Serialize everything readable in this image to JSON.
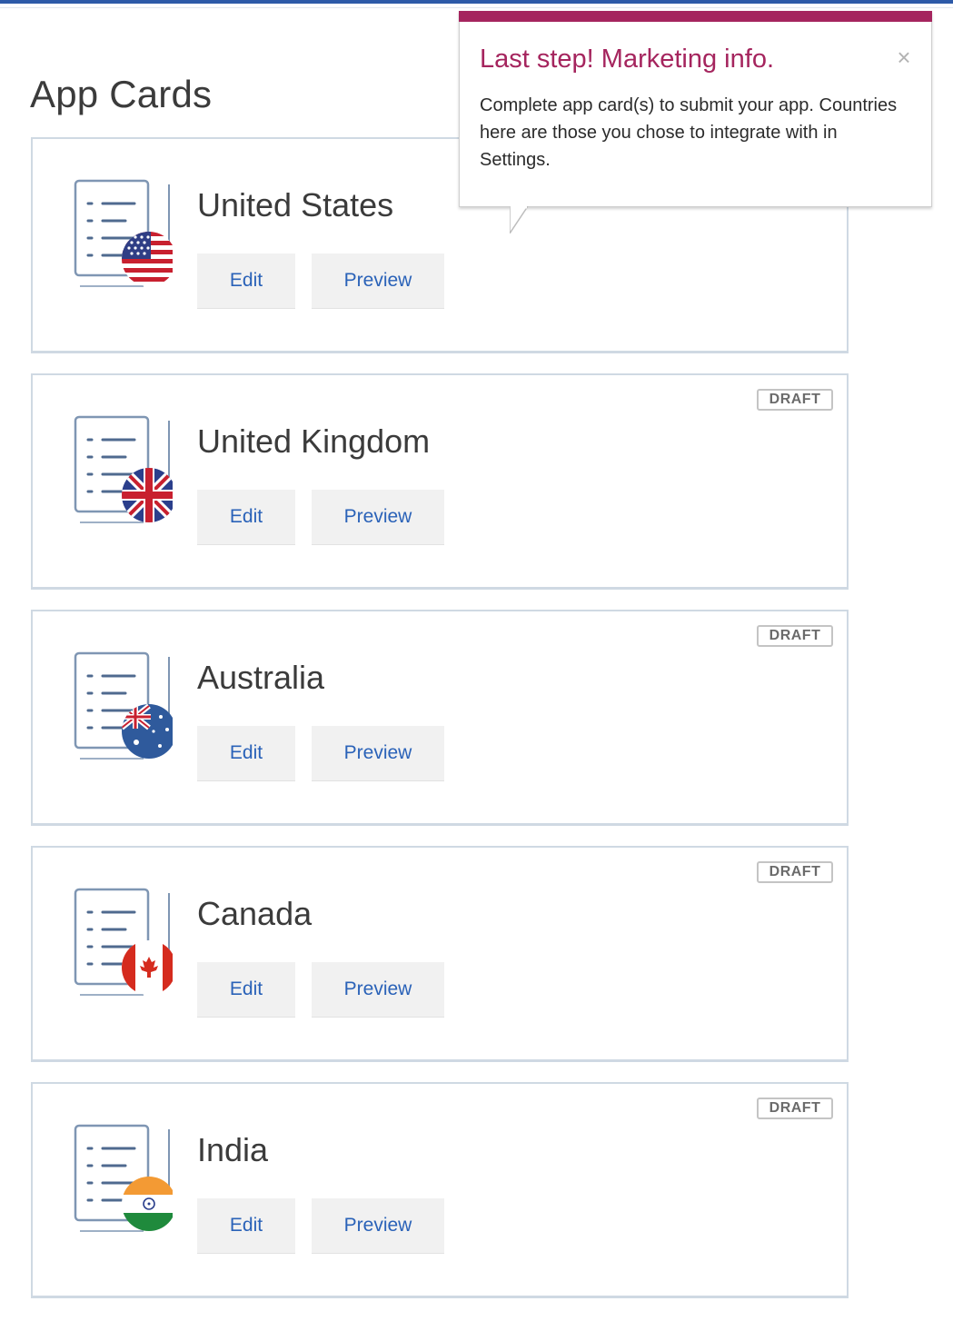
{
  "page": {
    "title": "App Cards"
  },
  "colors": {
    "accent": "#a5255e",
    "link": "#2a62b8",
    "card_border": "#cfd9e3",
    "top_bar": "#2d5aa8"
  },
  "tooltip": {
    "title": "Last step! Marketing info.",
    "close_symbol": "×",
    "body": "Complete app card(s) to submit your app. Countries here are those you chose to integrate with in Settings."
  },
  "cards": [
    {
      "country": "United States",
      "flag_icon": "us-flag-icon",
      "edit_label": "Edit",
      "preview_label": "Preview",
      "status": ""
    },
    {
      "country": "United Kingdom",
      "flag_icon": "uk-flag-icon",
      "edit_label": "Edit",
      "preview_label": "Preview",
      "status": "DRAFT"
    },
    {
      "country": "Australia",
      "flag_icon": "australia-flag-icon",
      "edit_label": "Edit",
      "preview_label": "Preview",
      "status": "DRAFT"
    },
    {
      "country": "Canada",
      "flag_icon": "canada-flag-icon",
      "edit_label": "Edit",
      "preview_label": "Preview",
      "status": "DRAFT"
    },
    {
      "country": "India",
      "flag_icon": "india-flag-icon",
      "edit_label": "Edit",
      "preview_label": "Preview",
      "status": "DRAFT"
    }
  ]
}
